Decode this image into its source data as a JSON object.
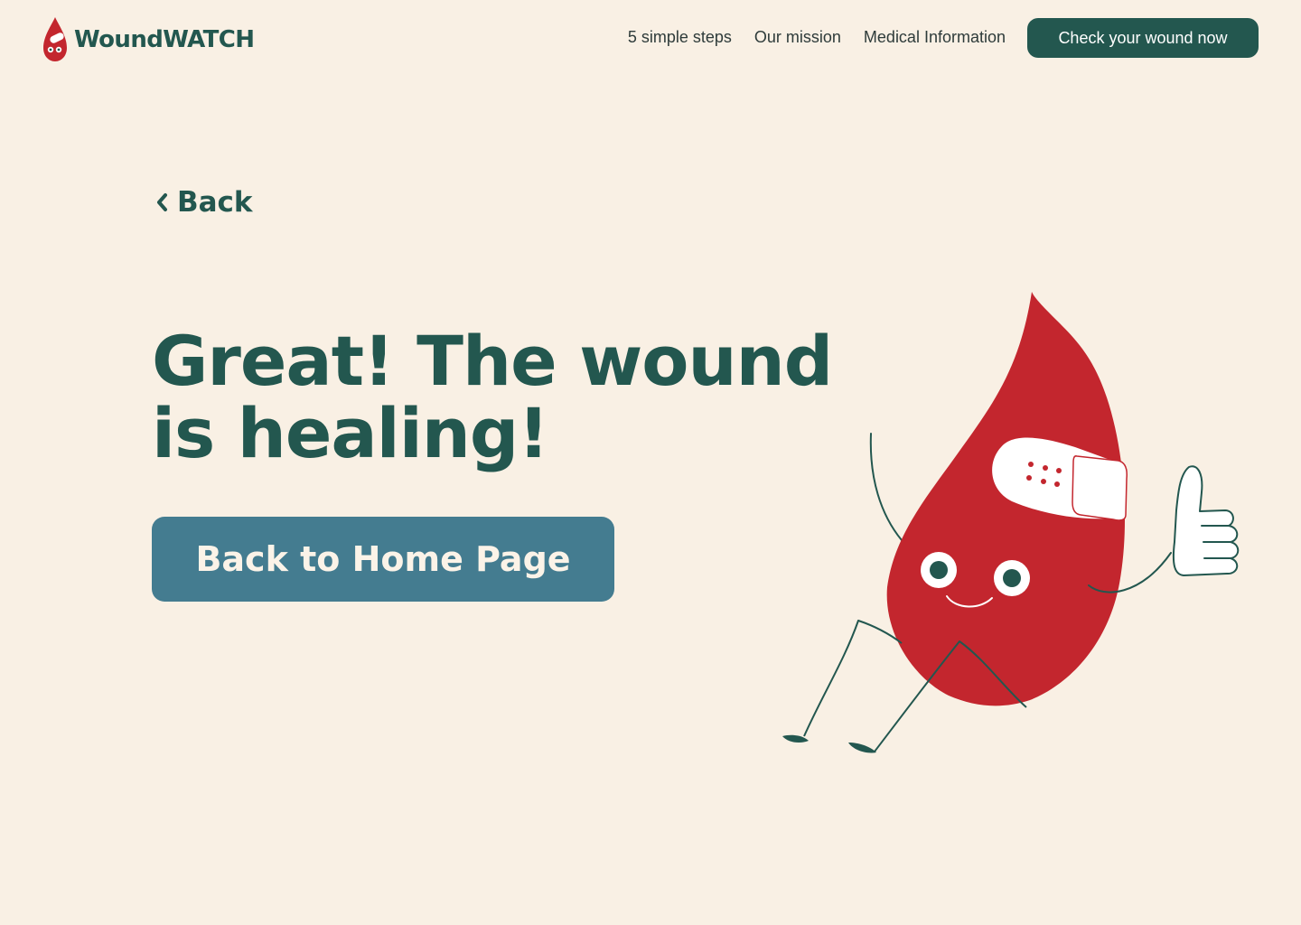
{
  "app": {
    "logo_text": "WoundWATCH",
    "logo_icon": "blood-drop-mascot-icon"
  },
  "header": {
    "nav": [
      {
        "label": "5 simple steps"
      },
      {
        "label": "Our mission"
      },
      {
        "label": "Medical Information"
      }
    ],
    "cta_label": "Check your wound now"
  },
  "main": {
    "back_label": "Back",
    "back_icon": "chevron-left-icon",
    "headline": "Great! The wound is healing!",
    "home_button_label": "Back to Home Page"
  },
  "illustration": {
    "subject": "blood-drop-mascot-thumbs-up"
  },
  "colors": {
    "background": "#f9f0e4",
    "primary": "#23574f",
    "secondary_button": "#447c90",
    "drop_red": "#c3262e"
  }
}
